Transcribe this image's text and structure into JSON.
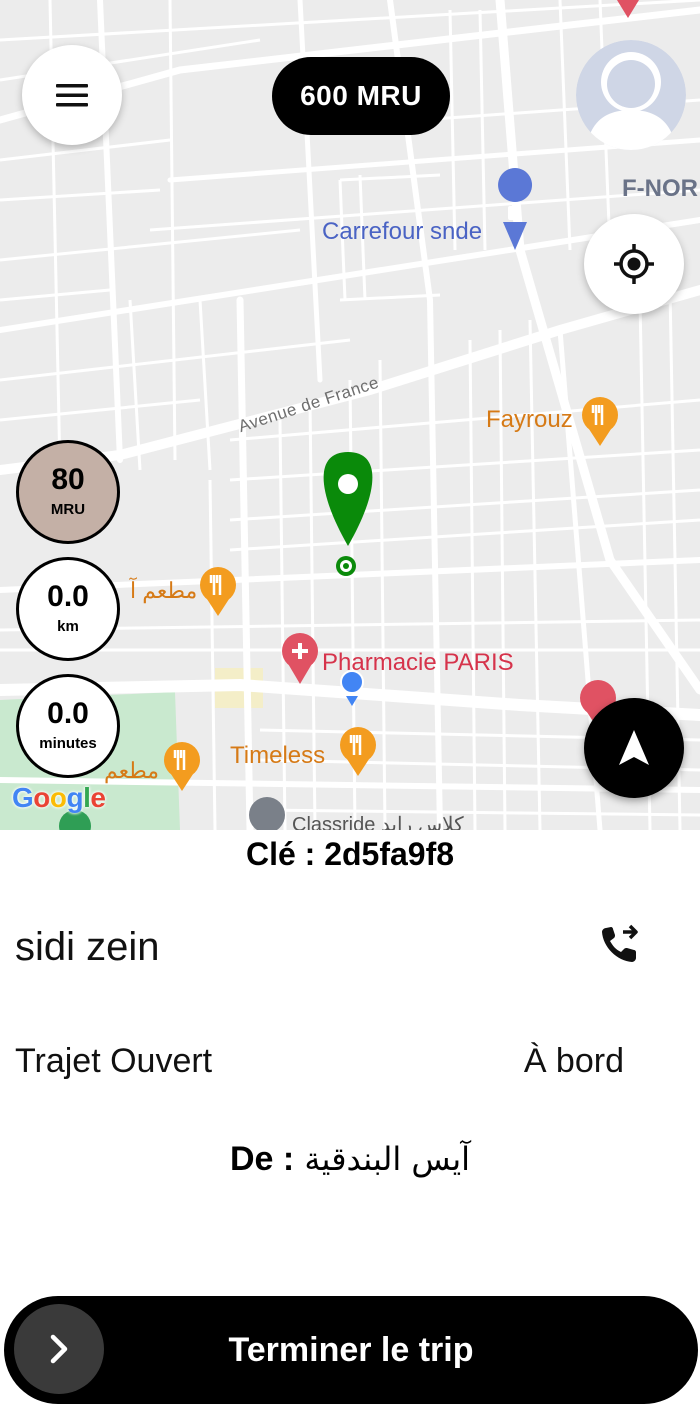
{
  "map": {
    "pois": [
      {
        "name": "Carrefour snde",
        "color": "#4a63c4"
      },
      {
        "name": "Fayrouz",
        "color": "#d67a16"
      },
      {
        "name": "Pharmacie PARIS",
        "color": "#d6334b"
      },
      {
        "name": "Timeless",
        "color": "#d67a16"
      },
      {
        "name": "Classride كلاس رايد",
        "color": "#555555"
      },
      {
        "name": "مطعم آ",
        "color": "#d67a16"
      },
      {
        "name": "مطعم",
        "color": "#d67a16"
      },
      {
        "name": "F-NOR",
        "color": "#6a7388"
      }
    ],
    "street": "Avenue de France",
    "attribution": "Google"
  },
  "top_bar": {
    "fare": "600 MRU",
    "menu_icon": "hamburger-icon",
    "avatar_icon": "user-avatar"
  },
  "stats": {
    "fare_value": "80",
    "fare_unit": "MRU",
    "distance_value": "0.0",
    "distance_unit": "km",
    "time_value": "0.0",
    "time_unit": "minutes"
  },
  "trip": {
    "key": "Clé : 2d5fa9f8",
    "rider_name": "sidi zein",
    "type": "Trajet Ouvert",
    "status": "À bord",
    "from_label": "De :",
    "from_value": "آيس البندقية"
  },
  "actions": {
    "end_trip": "Terminer le trip"
  },
  "colors": {
    "accent": "#000000",
    "pickup_marker": "#0a8a0a",
    "fare_badge": "#c4b0a6",
    "user_dot": "#4285f4"
  }
}
